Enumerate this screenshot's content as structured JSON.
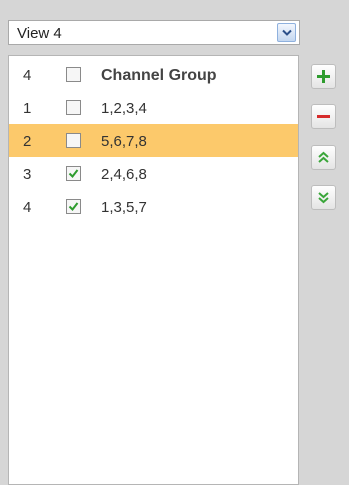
{
  "view_select": {
    "value": "View 4",
    "arrow_icon": "chevron-down-icon"
  },
  "list": {
    "header": {
      "index": "4",
      "checked": false,
      "label": "Channel Group"
    },
    "rows": [
      {
        "index": "1",
        "checked": false,
        "channels": "1,2,3,4",
        "selected": false
      },
      {
        "index": "2",
        "checked": false,
        "channels": "5,6,7,8",
        "selected": true
      },
      {
        "index": "3",
        "checked": true,
        "channels": "2,4,6,8",
        "selected": false
      },
      {
        "index": "4",
        "checked": true,
        "channels": "1,3,5,7",
        "selected": false
      }
    ]
  },
  "buttons": {
    "add": {
      "icon": "plus-icon",
      "color": "#2e9c2e"
    },
    "remove": {
      "icon": "minus-icon",
      "color": "#d62b2b"
    },
    "move_up": {
      "icon": "double-chevron-up-icon",
      "color": "#3aa63a"
    },
    "move_down": {
      "icon": "double-chevron-down-icon",
      "color": "#3aa63a"
    }
  },
  "colors": {
    "selected_row": "#fcc96b",
    "check_mark": "#2e9c2e",
    "panel_background": "#d6d6d6"
  }
}
